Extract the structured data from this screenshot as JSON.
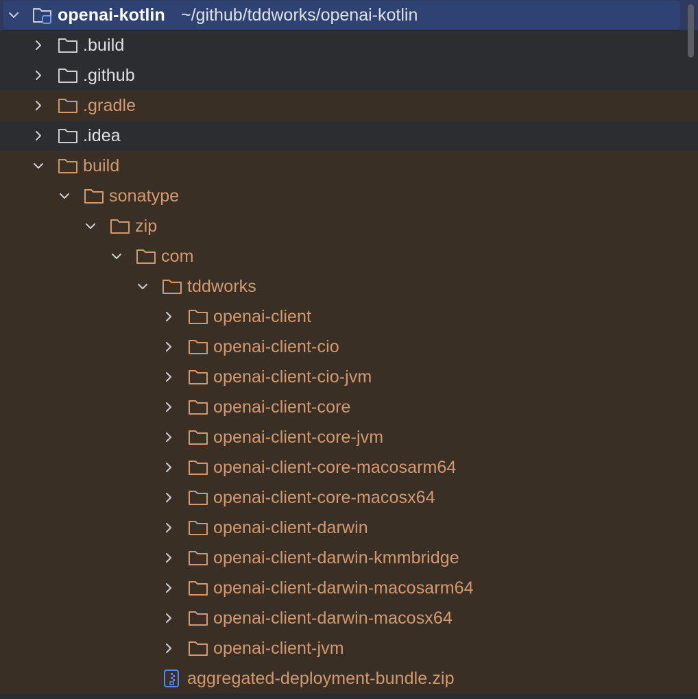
{
  "root": {
    "name": "openai-kotlin",
    "path": "~/github/tddworks/openai-kotlin"
  },
  "items": [
    {
      "label": ".build",
      "depth": 1,
      "expanded": false,
      "kind": "folder",
      "excluded": false
    },
    {
      "label": ".github",
      "depth": 1,
      "expanded": false,
      "kind": "folder",
      "excluded": false
    },
    {
      "label": ".gradle",
      "depth": 1,
      "expanded": false,
      "kind": "folder",
      "excluded": true
    },
    {
      "label": ".idea",
      "depth": 1,
      "expanded": false,
      "kind": "folder",
      "excluded": false
    },
    {
      "label": "build",
      "depth": 1,
      "expanded": true,
      "kind": "folder",
      "excluded": true
    },
    {
      "label": "sonatype",
      "depth": 2,
      "expanded": true,
      "kind": "folder",
      "excluded": true
    },
    {
      "label": "zip",
      "depth": 3,
      "expanded": true,
      "kind": "folder",
      "excluded": true
    },
    {
      "label": "com",
      "depth": 4,
      "expanded": true,
      "kind": "folder",
      "excluded": true
    },
    {
      "label": "tddworks",
      "depth": 5,
      "expanded": true,
      "kind": "folder",
      "excluded": true
    },
    {
      "label": "openai-client",
      "depth": 6,
      "expanded": false,
      "kind": "folder",
      "excluded": true
    },
    {
      "label": "openai-client-cio",
      "depth": 6,
      "expanded": false,
      "kind": "folder",
      "excluded": true
    },
    {
      "label": "openai-client-cio-jvm",
      "depth": 6,
      "expanded": false,
      "kind": "folder",
      "excluded": true
    },
    {
      "label": "openai-client-core",
      "depth": 6,
      "expanded": false,
      "kind": "folder",
      "excluded": true
    },
    {
      "label": "openai-client-core-jvm",
      "depth": 6,
      "expanded": false,
      "kind": "folder",
      "excluded": true
    },
    {
      "label": "openai-client-core-macosarm64",
      "depth": 6,
      "expanded": false,
      "kind": "folder",
      "excluded": true
    },
    {
      "label": "openai-client-core-macosx64",
      "depth": 6,
      "expanded": false,
      "kind": "folder",
      "excluded": true
    },
    {
      "label": "openai-client-darwin",
      "depth": 6,
      "expanded": false,
      "kind": "folder",
      "excluded": true
    },
    {
      "label": "openai-client-darwin-kmmbridge",
      "depth": 6,
      "expanded": false,
      "kind": "folder",
      "excluded": true
    },
    {
      "label": "openai-client-darwin-macosarm64",
      "depth": 6,
      "expanded": false,
      "kind": "folder",
      "excluded": true
    },
    {
      "label": "openai-client-darwin-macosx64",
      "depth": 6,
      "expanded": false,
      "kind": "folder",
      "excluded": true
    },
    {
      "label": "openai-client-jvm",
      "depth": 6,
      "expanded": false,
      "kind": "folder",
      "excluded": true
    },
    {
      "label": "aggregated-deployment-bundle.zip",
      "depth": 5,
      "expanded": null,
      "kind": "zip-file",
      "excluded": true
    }
  ],
  "colors": {
    "background": "#2b2d30",
    "excluded_background": "#3a2f25",
    "selection": "#2e4374",
    "text": "#dfe1e5",
    "excluded_text": "#d39a70",
    "folder_icon": "#ced0d6",
    "excluded_folder_icon": "#d39a70",
    "zip_icon": "#548af7"
  },
  "icons": {
    "expand": "chevron-right-icon",
    "collapse": "chevron-down-icon",
    "folder": "folder-icon",
    "module": "module-folder-icon",
    "zip": "zip-file-icon"
  }
}
